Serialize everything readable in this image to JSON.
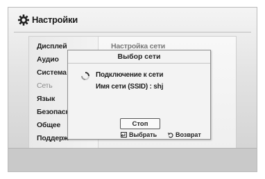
{
  "header": {
    "title": "Настройки",
    "icon": "gear-icon"
  },
  "menu": {
    "items": [
      {
        "label": "Дисплей",
        "state": "normal"
      },
      {
        "label": "Аудио",
        "state": "normal"
      },
      {
        "label": "Система",
        "state": "normal"
      },
      {
        "label": "Сеть",
        "state": "selected-dim"
      },
      {
        "label": "Язык",
        "state": "normal"
      },
      {
        "label": "Безопасн",
        "state": "normal"
      },
      {
        "label": "Общее",
        "state": "normal"
      },
      {
        "label": "Поддерж",
        "state": "normal"
      }
    ],
    "right_panel_title": "Настройка сети"
  },
  "dialog": {
    "title": "Выбор сети",
    "status_text": "Подключение к сети",
    "ssid_text": "Имя сети (SSID) : shj",
    "stop_label": "Стоп",
    "hint_select": "Выбрать",
    "hint_return": "Возврат"
  },
  "colors": {
    "panel": "#efefef",
    "dialog_bg": "#f3f3f3",
    "text": "#222222",
    "dim_text": "#8c8c8c"
  }
}
